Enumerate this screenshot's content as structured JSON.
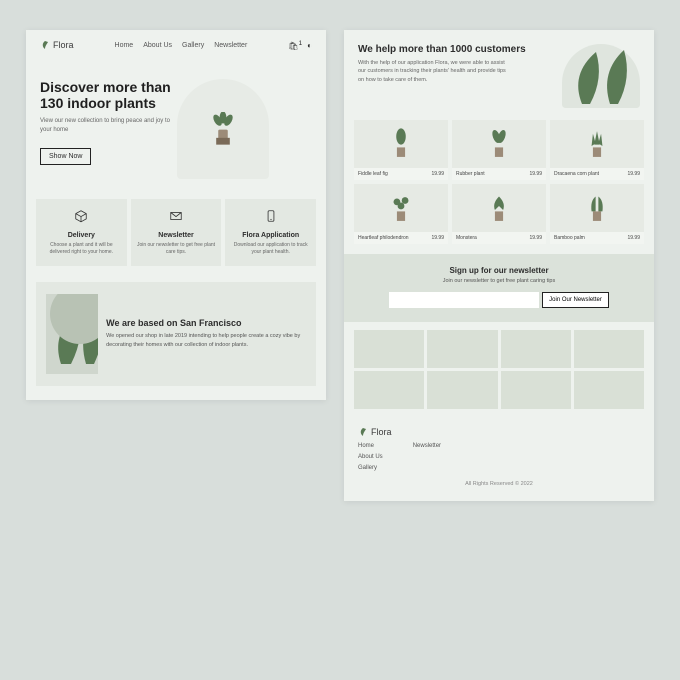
{
  "brand": "Flora",
  "nav": {
    "home": "Home",
    "about": "About Us",
    "gallery": "Gallery",
    "news": "Newsletter"
  },
  "cart_count": "1",
  "hero": {
    "title_l1": "Discover more than",
    "title_l2": "130 indoor plants",
    "sub": "View our new collection to bring peace and joy to your home",
    "cta": "Show Now"
  },
  "features": {
    "delivery": {
      "title": "Delivery",
      "text": "Choose a plant and it will be delivered right to your home."
    },
    "newsletter": {
      "title": "Newsletter",
      "text": "Join our newsletter to get free plant care tips."
    },
    "app": {
      "title": "Flora Application",
      "text": "Download our application to track your plant health."
    }
  },
  "about": {
    "title": "We are based on San Francisco",
    "text": "We opened our shop in late 2019 intending to help people create a cozy vibe by decorating their homes with our collection of indoor plants."
  },
  "help": {
    "title": "We help more than 1000 customers",
    "text": "With the help of our application Flora, we were able to assist our customers in tracking their plants' health and provide tips on how to take care of them."
  },
  "price": "19.99",
  "products": [
    {
      "name": "Fiddle leaf fig"
    },
    {
      "name": "Rubber plant"
    },
    {
      "name": "Dracaena corn plant"
    },
    {
      "name": "Heartleaf philodendron"
    },
    {
      "name": "Monstera"
    },
    {
      "name": "Bamboo palm"
    }
  ],
  "newsletter": {
    "title": "Sign up for our newsletter",
    "text": "Join our newsletter to get free plant caring tips",
    "placeholder": "",
    "cta": "Join Our Newsletter"
  },
  "footer": {
    "links_a": [
      "Home",
      "About Us",
      "Gallery"
    ],
    "links_b": [
      "Newsletter"
    ],
    "copy": "All Rights Reserved © 2022"
  }
}
